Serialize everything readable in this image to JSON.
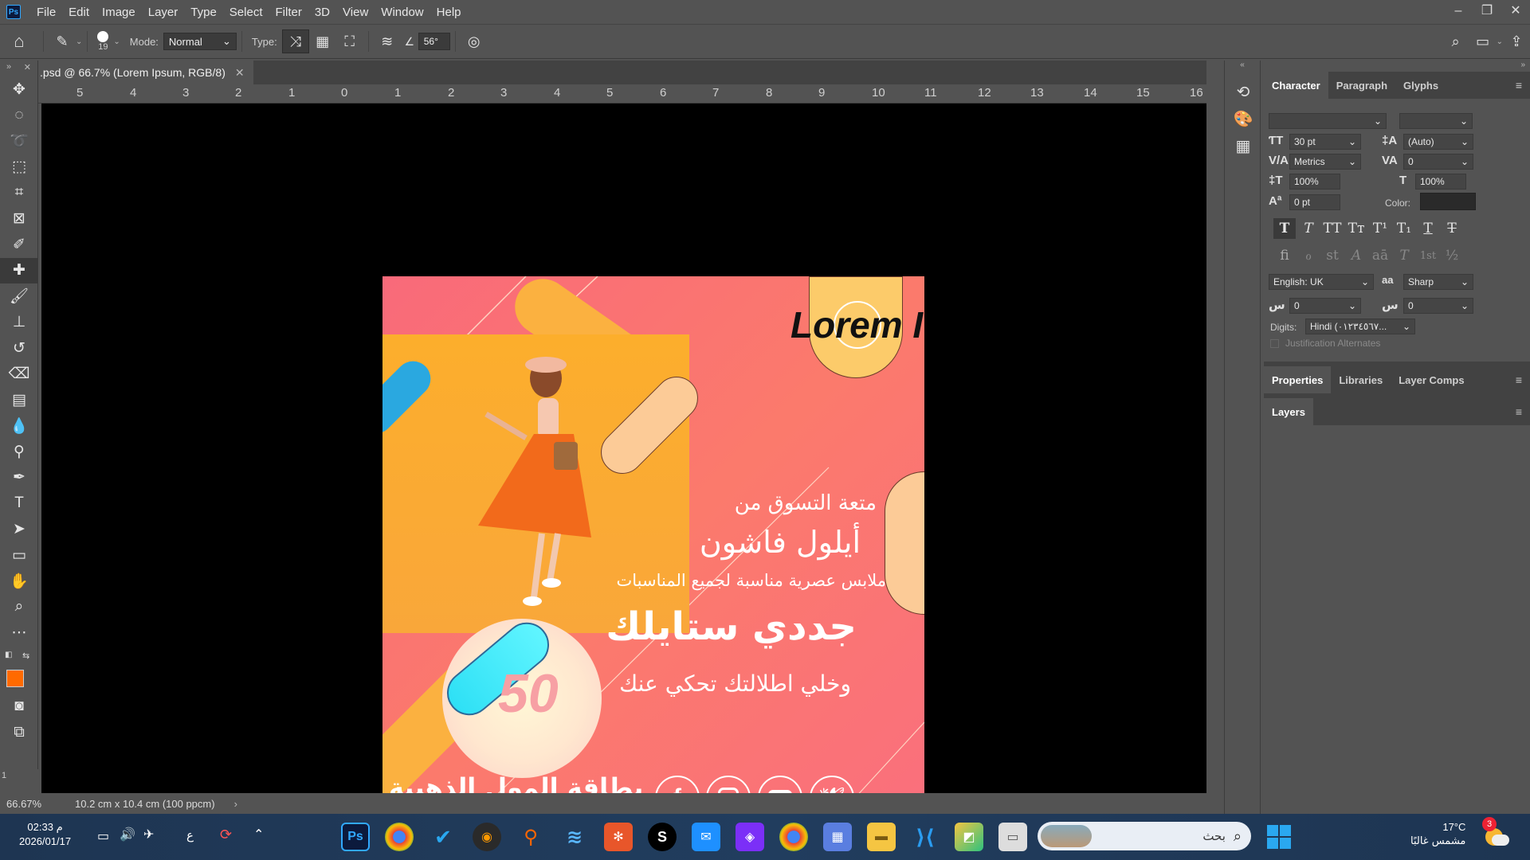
{
  "app": {
    "logo": "Ps"
  },
  "menu": [
    "File",
    "Edit",
    "Image",
    "Layer",
    "Type",
    "Select",
    "Filter",
    "3D",
    "View",
    "Window",
    "Help"
  ],
  "window_controls": {
    "minimize": "–",
    "restore": "❐",
    "close": "✕"
  },
  "options": {
    "brush_size": "19",
    "mode_label": "Mode:",
    "mode_value": "Normal",
    "type_label": "Type:",
    "angle_value": "56°"
  },
  "document": {
    "tab_title": ".psd @ 66.7% (Lorem Ipsum, RGB/8)",
    "zoom": "66.67%",
    "doc_size": "10.2 cm x 10.4 cm (100 ppcm)"
  },
  "ruler": {
    "labels": [
      "5",
      "4",
      "3",
      "2",
      "1",
      "0",
      "1",
      "2",
      "3",
      "4",
      "5",
      "6",
      "7",
      "8",
      "9",
      "10",
      "11",
      "12",
      "13",
      "14",
      "15",
      "16"
    ],
    "corner": "1"
  },
  "artboard": {
    "headline": "Lorem I",
    "line1": "متعة التسوق من",
    "line2": "أيلول فاشون",
    "line3": "ملابس عصرية مناسبة لجميع المناسبات",
    "line4": "جددي ستايلك",
    "line5": "وخلي اطلالتك تحكي عنك",
    "badge": "50",
    "card_title": "بطاقة المول الذهبية",
    "social": [
      "facebook-icon",
      "instagram-icon",
      "youtube-icon",
      "twitter-icon"
    ]
  },
  "character_panel": {
    "tabs": [
      "Character",
      "Paragraph",
      "Glyphs"
    ],
    "font_size": "30 pt",
    "leading": "(Auto)",
    "kerning": "Metrics",
    "tracking": "0",
    "vertical_scale": "100%",
    "horizontal_scale": "100%",
    "baseline_shift": "0 pt",
    "color_label": "Color:",
    "color_value": "#2a2a2a",
    "language": "English: UK",
    "antialias_icon": "aa",
    "antialias": "Sharp",
    "arabic_field1": "0",
    "arabic_field2": "0",
    "digits_label": "Digits:",
    "digits_value": "Hindi (٠١٢٣٤٥٦٧...",
    "justification": "Justification Alternates",
    "style_buttons": [
      "T",
      "T",
      "TT",
      "Tт",
      "T¹",
      "T₁",
      "T",
      "T"
    ],
    "opentype_buttons": [
      "ﬁ",
      "ℴ",
      "st",
      "A",
      "aā",
      "T",
      "1st",
      "½"
    ]
  },
  "properties_panel": {
    "tabs": [
      "Properties",
      "Libraries",
      "Layer Comps"
    ]
  },
  "layers_panel": {
    "tabs": [
      "Layers"
    ]
  },
  "taskbar": {
    "time": "02:33 م",
    "date": "2026/01/17",
    "lang": "ع",
    "search_placeholder": "بحث",
    "weather_temp": "17°C",
    "weather_desc": "مشمس غالبًا",
    "notif_count": "3"
  },
  "colors": {
    "foreground": "#ff6a00",
    "background": "#ffffff",
    "artboard_pink": "#f96a7a",
    "photo_yellow": "#fbb03b"
  }
}
